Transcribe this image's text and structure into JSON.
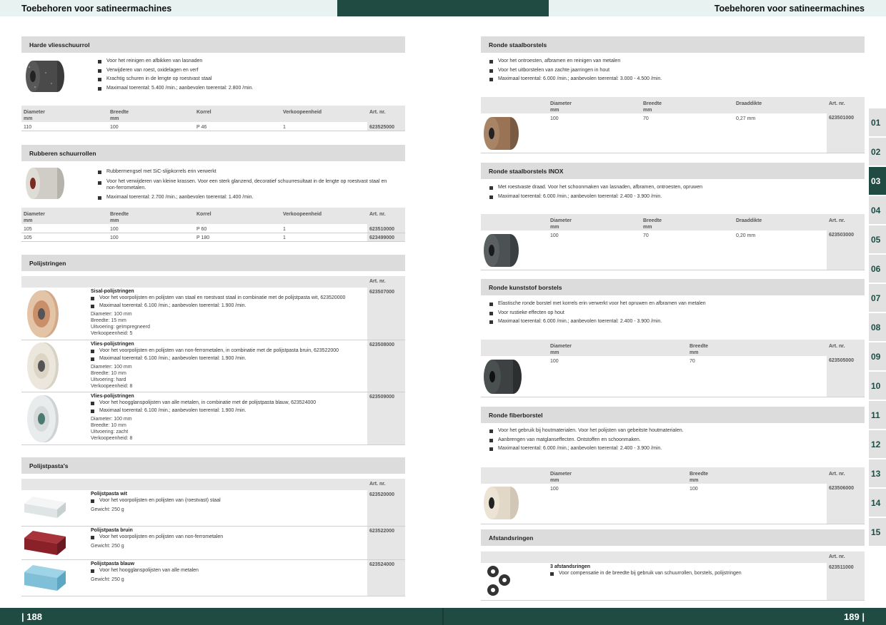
{
  "header": {
    "left_title": "Toebehoren voor satineermachines",
    "right_title": "Toebehoren voor satineermachines"
  },
  "footer": {
    "page_left": "| 188",
    "page_right": "189 |"
  },
  "tabs": [
    "01",
    "02",
    "03",
    "04",
    "05",
    "06",
    "07",
    "08",
    "09",
    "10",
    "11",
    "12",
    "13",
    "14",
    "15"
  ],
  "active_tab": "03",
  "left": {
    "vlies": {
      "title": "Harde vliesschuurrol",
      "bullets": [
        "Voor het reinigen en afbikken van lasnaden",
        "Verwijderen van roest, oxidelagen en verf",
        "Krachtig schuren in de lengte op roestvast staal",
        "Maximaal toerental: 5.400 /min.; aanbevolen toerental: 2.800 /min."
      ],
      "headers": [
        "Diameter",
        "mm",
        "Breedte",
        "mm",
        "Korrel",
        "Verkoopeenheid",
        "Art. nr."
      ],
      "rows": [
        [
          "110",
          "100",
          "P 46",
          "1",
          "623525000"
        ]
      ]
    },
    "rubber": {
      "title": "Rubberen schuurrollen",
      "bullets": [
        "Rubbermengsel met SiC-slijpkorrels erin verwerkt",
        "Voor het verwijderen van kleine krassen. Voor een sterk glanzend, decoratief schuurresultaat in de lengte op roestvast staal en non-ferrometalen.",
        "Maximaal toerental: 2.700 /min.; aanbevolen toerental: 1.400 /min."
      ],
      "headers": [
        "Diameter",
        "mm",
        "Breedte",
        "mm",
        "Korrel",
        "Verkoopeenheid",
        "Art. nr."
      ],
      "rows": [
        [
          "105",
          "100",
          "P 60",
          "1",
          "623510000"
        ],
        [
          "105",
          "100",
          "P 180",
          "1",
          "623499000"
        ]
      ]
    },
    "polij": {
      "title": "Polijstringen",
      "art_header": "Art. nr.",
      "items": [
        {
          "name": "Sisal-polijstringen",
          "bullets": [
            "Voor het voorpolijsten en polijsten van staal en roestvast staal in combinatie met de polijstpasta wit, 623520000",
            "Maximaal toerental: 6.100 /min.; aanbevolen toerental: 1.900 /min."
          ],
          "specs": [
            "Diameter: 100 mm",
            "Breedte: 15 mm",
            "Uitvoering: geïmpregneerd",
            "Verkoopeenheid: 5"
          ],
          "art": "623507000"
        },
        {
          "name": "Vlies-polijstringen",
          "bullets": [
            "Voor het voorpolijsten en polijsten van non-ferrometalen, in combinatie met de polijstpasta bruin, 623522000",
            "Maximaal toerental: 6.100 /min.; aanbevolen toerental: 1.900 /min."
          ],
          "specs": [
            "Diameter: 100 mm",
            "Breedte: 10 mm",
            "Uitvoering: hard",
            "Verkoopeenheid: 8"
          ],
          "art": "623508000"
        },
        {
          "name": "Vlies-polijstringen",
          "bullets": [
            "Voor het hoogglanspolijsten van alle metalen, in combinatie met de polijstpasta blauw, 623524000",
            "Maximaal toerental: 6.100 /min.; aanbevolen toerental: 1.900 /min."
          ],
          "specs": [
            "Diameter: 100 mm",
            "Breedte: 10 mm",
            "Uitvoering: zacht",
            "Verkoopeenheid: 8"
          ],
          "art": "623509000"
        }
      ]
    },
    "pasta": {
      "title": "Polijstpasta's",
      "art_header": "Art. nr.",
      "items": [
        {
          "name": "Polijstpasta wit",
          "bullet": "Voor het voorpolijsten en polijsten van (roestvast) staal",
          "weight": "Gewicht: 250 g",
          "art": "623520000"
        },
        {
          "name": "Polijstpasta bruin",
          "bullet": "Voor het voorpolijsten en polijsten van non-ferrometalen",
          "weight": "Gewicht: 250 g",
          "art": "623522000"
        },
        {
          "name": "Polijstpasta blauw",
          "bullet": "Voor het hoogglanspolijsten van alle metalen",
          "weight": "Gewicht: 250 g",
          "art": "623524000"
        }
      ]
    }
  },
  "right": {
    "staal": {
      "title": "Ronde staalborstels",
      "bullets": [
        "Voor het ontroesten, afbramen en reinigen van metalen",
        "Voor het uitborstelen van zachte jaarringen in hout",
        "Maximaal toerental: 6.000 /min.; aanbevolen toerental: 3.000 - 4.500 /min."
      ],
      "headers": [
        "Diameter",
        "mm",
        "Breedte",
        "mm",
        "Draaddikte",
        "Art. nr."
      ],
      "row": [
        "100",
        "70",
        "0,27 mm",
        "623501000"
      ]
    },
    "inox": {
      "title": "Ronde staalborstels INOX",
      "bullets": [
        "Met roestvaste draad. Voor het schoonmaken van lasnaden, afbramen, ontroesten, opruwen",
        "Maximaal toerental: 6.000 /min.; aanbevolen toerental: 2.400 - 3.900 /min."
      ],
      "headers": [
        "Diameter",
        "mm",
        "Breedte",
        "mm",
        "Draaddikte",
        "Art. nr."
      ],
      "row": [
        "100",
        "70",
        "0,20 mm",
        "623503000"
      ]
    },
    "kunst": {
      "title": "Ronde kunststof borstels",
      "bullets": [
        "Elastische ronde borstel met korrels erin verwerkt voor het opruwen en afbramen van metalen",
        "Voor rustieke effecten op hout",
        "Maximaal toerental: 6.000 /min.; aanbevolen toerental: 2.400 - 3.900 /min."
      ],
      "headers": [
        "Diameter",
        "mm",
        "Breedte",
        "mm",
        "Art. nr."
      ],
      "row": [
        "100",
        "70",
        "623505000"
      ]
    },
    "fiber": {
      "title": "Ronde fiberborstel",
      "bullets": [
        "Voor het gebruik bij houtmaterialen. Voor het polijsten van gebeitste houtmaterialen.",
        "Aanbrengen van matglanseffecten. Ontstoffen en schoonmaken.",
        "Maximaal toerental: 6.000 /min.; aanbevolen toerental: 2.400 - 3.900 /min."
      ],
      "headers": [
        "Diameter",
        "mm",
        "Breedte",
        "mm",
        "Art. nr."
      ],
      "row": [
        "100",
        "100",
        "623506000"
      ]
    },
    "afst": {
      "title": "Afstandsringen",
      "art_header": "Art. nr.",
      "name": "3 afstandsringen",
      "bullet": "Voor compensatie in de breedte bij gebruik van schuurrollen, borstels, polijstringen",
      "art": "623511000"
    }
  }
}
